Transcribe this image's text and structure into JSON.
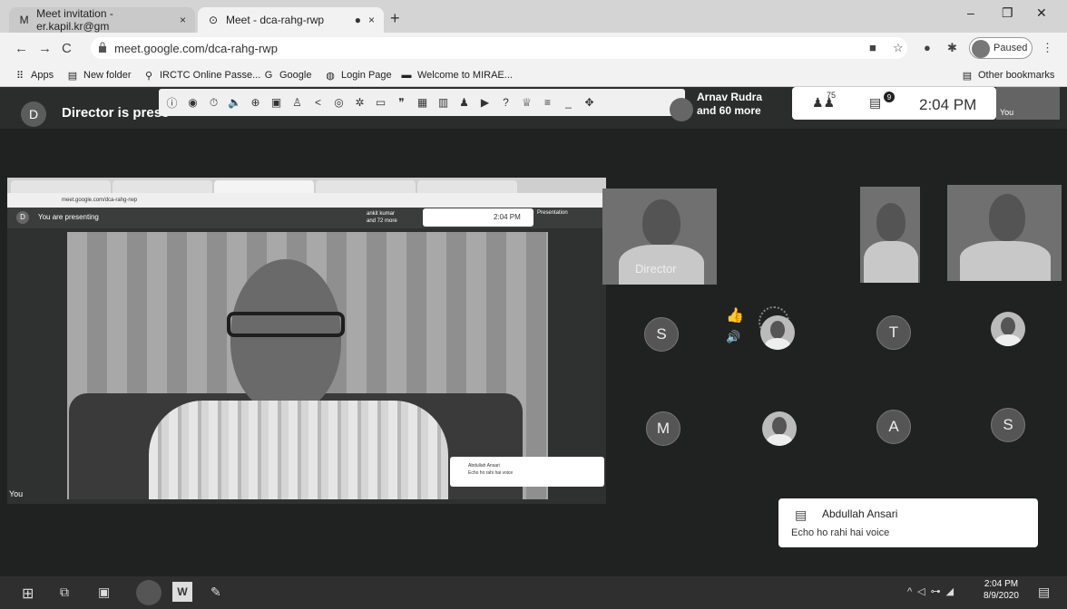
{
  "browser": {
    "tabs": [
      {
        "icon": "gmail-icon",
        "label": "Meet invitation - er.kapil.kr@gm"
      },
      {
        "icon": "meet-icon",
        "label": "Meet - dca-rahg-rwp"
      }
    ],
    "recording_indicator": "●",
    "close_glyph": "×",
    "new_tab_glyph": "+",
    "url": "meet.google.com/dca-rahg-rwp",
    "profile_status": "Paused",
    "window_controls": {
      "minimize": "–",
      "maximize": "❐",
      "close": "✕"
    }
  },
  "bookmarks": {
    "items": [
      {
        "icon": "apps-grid-icon",
        "label": "Apps"
      },
      {
        "icon": "folder-icon",
        "label": "New folder"
      },
      {
        "icon": "train-icon",
        "label": "IRCTC Online Passe..."
      },
      {
        "icon": "google-g-icon",
        "label": "Google"
      },
      {
        "icon": "globe-icon",
        "label": "Login Page"
      },
      {
        "icon": "site-icon",
        "label": "Welcome to MIRAE..."
      }
    ],
    "other": "Other bookmarks"
  },
  "meet": {
    "presenter_initial": "D",
    "presenting_banner": "Director is prese",
    "participants_name": "Arnav Rudra",
    "participants_more": "and 60 more",
    "people_count": "75",
    "chat_unread": "9",
    "time": "2:04 PM",
    "self_label": "You",
    "self_tile_label": "You",
    "nested": {
      "initial": "D",
      "banner": "You are presenting",
      "who_name": "ankit kumar",
      "who_more": "and 72 more",
      "time": "2:04 PM",
      "presentation_label": "Presentation",
      "chat_name": "Abdullah Ansari",
      "chat_msg": "Echo ho rahi hai voice",
      "url": "meet.google.com/dca-rahg-rwp"
    },
    "tile_director_label": "Director",
    "avatars": [
      "S",
      "T",
      "M",
      "A",
      "S"
    ],
    "chat_toast": {
      "name": "Abdullah Ansari",
      "message": "Echo ho rahi hai voice"
    }
  },
  "taskbar": {
    "clock_time": "2:04 PM",
    "clock_date": "8/9/2020",
    "word_label": "W"
  },
  "colors": {
    "meet_background": "#1f2220",
    "chrome_tabstrip": "#d4d4d4"
  }
}
